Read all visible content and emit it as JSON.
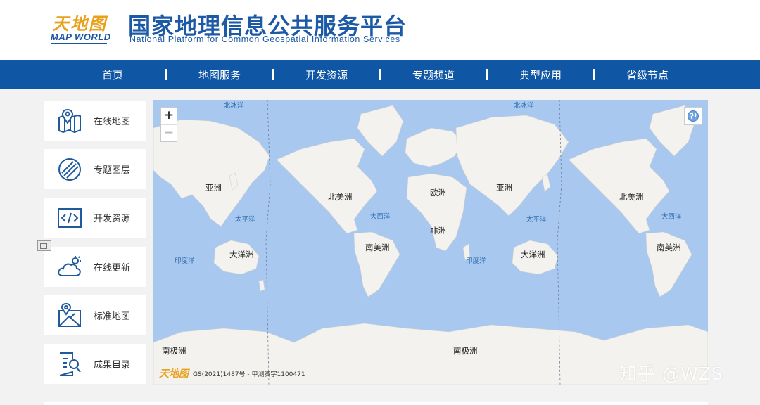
{
  "header": {
    "logo_cn": "天地图",
    "logo_en": "MAP WORLD",
    "title": "国家地理信息公共服务平台",
    "subtitle": "National Platform for Common Geospatial Information Services"
  },
  "nav": {
    "items": [
      "首页",
      "地图服务",
      "开发资源",
      "专题频道",
      "典型应用",
      "省级节点"
    ]
  },
  "sidebar": {
    "items": [
      {
        "label": "在线地图",
        "icon": "map-pin-icon"
      },
      {
        "label": "专题图层",
        "icon": "layer-stripes-icon"
      },
      {
        "label": "开发资源",
        "icon": "code-icon"
      },
      {
        "label": "在线更新",
        "icon": "cloud-refresh-icon"
      },
      {
        "label": "标准地图",
        "icon": "folded-map-icon"
      },
      {
        "label": "成果目录",
        "icon": "document-search-icon"
      }
    ]
  },
  "map": {
    "zoom_in": "+",
    "zoom_out": "−",
    "continents": [
      "亚洲",
      "北美洲",
      "欧洲",
      "亚洲",
      "北美洲",
      "非洲",
      "南美洲",
      "大洋洲",
      "大洋洲",
      "南美洲",
      "南极洲",
      "南极洲"
    ],
    "oceans": [
      "北冰洋",
      "北冰洋",
      "太平洋",
      "大西洋",
      "太平洋",
      "大西洋",
      "印度洋",
      "印度洋"
    ],
    "logo": "天地图",
    "copyright": "GS(2021)1487号 - 甲测资字1100471",
    "colors": {
      "ocean": "#a8c8ef",
      "land": "#f3f2ee"
    }
  },
  "watermark": "知乎 @WZS"
}
